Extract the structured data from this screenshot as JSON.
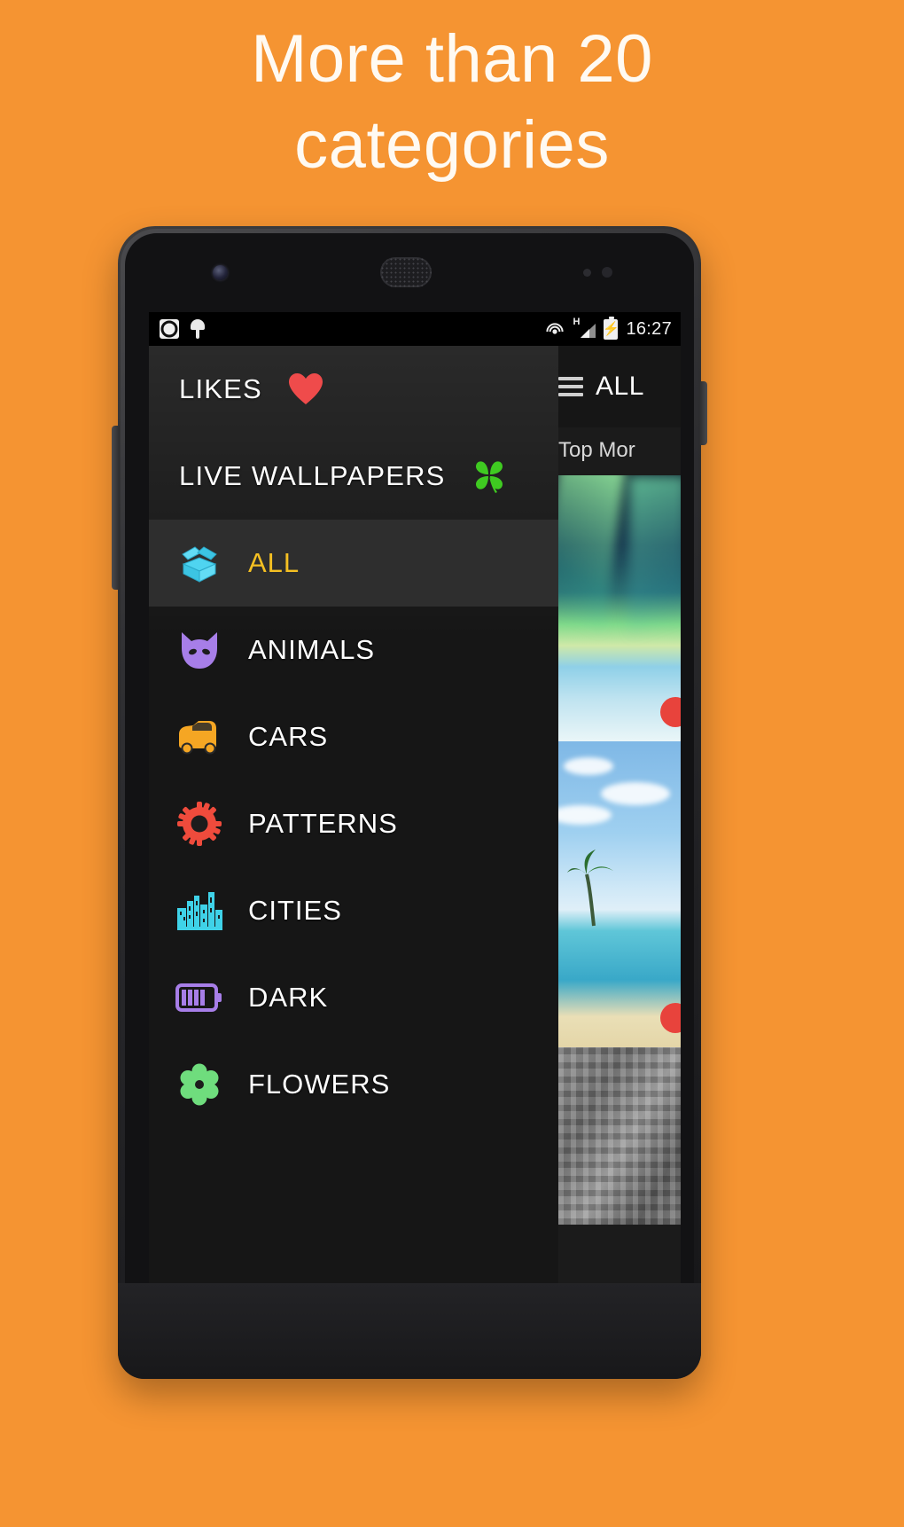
{
  "promo": {
    "line1": "More than 20",
    "line2": "categories",
    "background_color": "#f59432",
    "text_color": "#fffaf2"
  },
  "statusbar": {
    "time": "16:27",
    "left_icons": [
      "screen-record-icon",
      "android-debug-icon"
    ],
    "right_icons": [
      "cast-icon",
      "hspa-signal-icon",
      "battery-charging-icon"
    ],
    "network_label": "H",
    "background_color": "#000000"
  },
  "toolbar": {
    "menu_icon": "hamburger-menu-icon",
    "title": "ALL",
    "tabs_visible_text": "Top Mor"
  },
  "drawer": {
    "header_items": [
      {
        "label": "LIKES",
        "icon": "heart-icon",
        "color": "#ef4b4b"
      },
      {
        "label": "LIVE WALLPAPERS",
        "icon": "clover-icon",
        "color": "#3fca21"
      }
    ],
    "categories": [
      {
        "label": "ALL",
        "icon": "open-box-icon",
        "color": "#4fd4f0",
        "selected": true
      },
      {
        "label": "ANIMALS",
        "icon": "cat-face-icon",
        "color": "#a77ee8",
        "selected": false
      },
      {
        "label": "CARS",
        "icon": "car-icon",
        "color": "#f5a623",
        "selected": false
      },
      {
        "label": "PATTERNS",
        "icon": "gear-icon",
        "color": "#ef4b3c",
        "selected": false
      },
      {
        "label": "CITIES",
        "icon": "city-skyline-icon",
        "color": "#3fd2e8",
        "selected": false
      },
      {
        "label": "DARK",
        "icon": "battery-icon",
        "color": "#a77ee8",
        "selected": false
      },
      {
        "label": "FLOWERS",
        "icon": "flower-icon",
        "color": "#6fdd7d",
        "selected": false
      }
    ],
    "selected_label_color": "#f5c022",
    "selected_row_color": "#2e2e2e",
    "background_color": "#161616"
  },
  "navbar": {
    "buttons": [
      "back-button",
      "home-button",
      "recents-button"
    ]
  },
  "thumbnails": [
    {
      "name": "aurora-wallpaper-thumb",
      "has_badge": true
    },
    {
      "name": "beach-wallpaper-thumb",
      "has_badge": true
    },
    {
      "name": "city-wallpaper-thumb",
      "has_badge": false
    }
  ]
}
